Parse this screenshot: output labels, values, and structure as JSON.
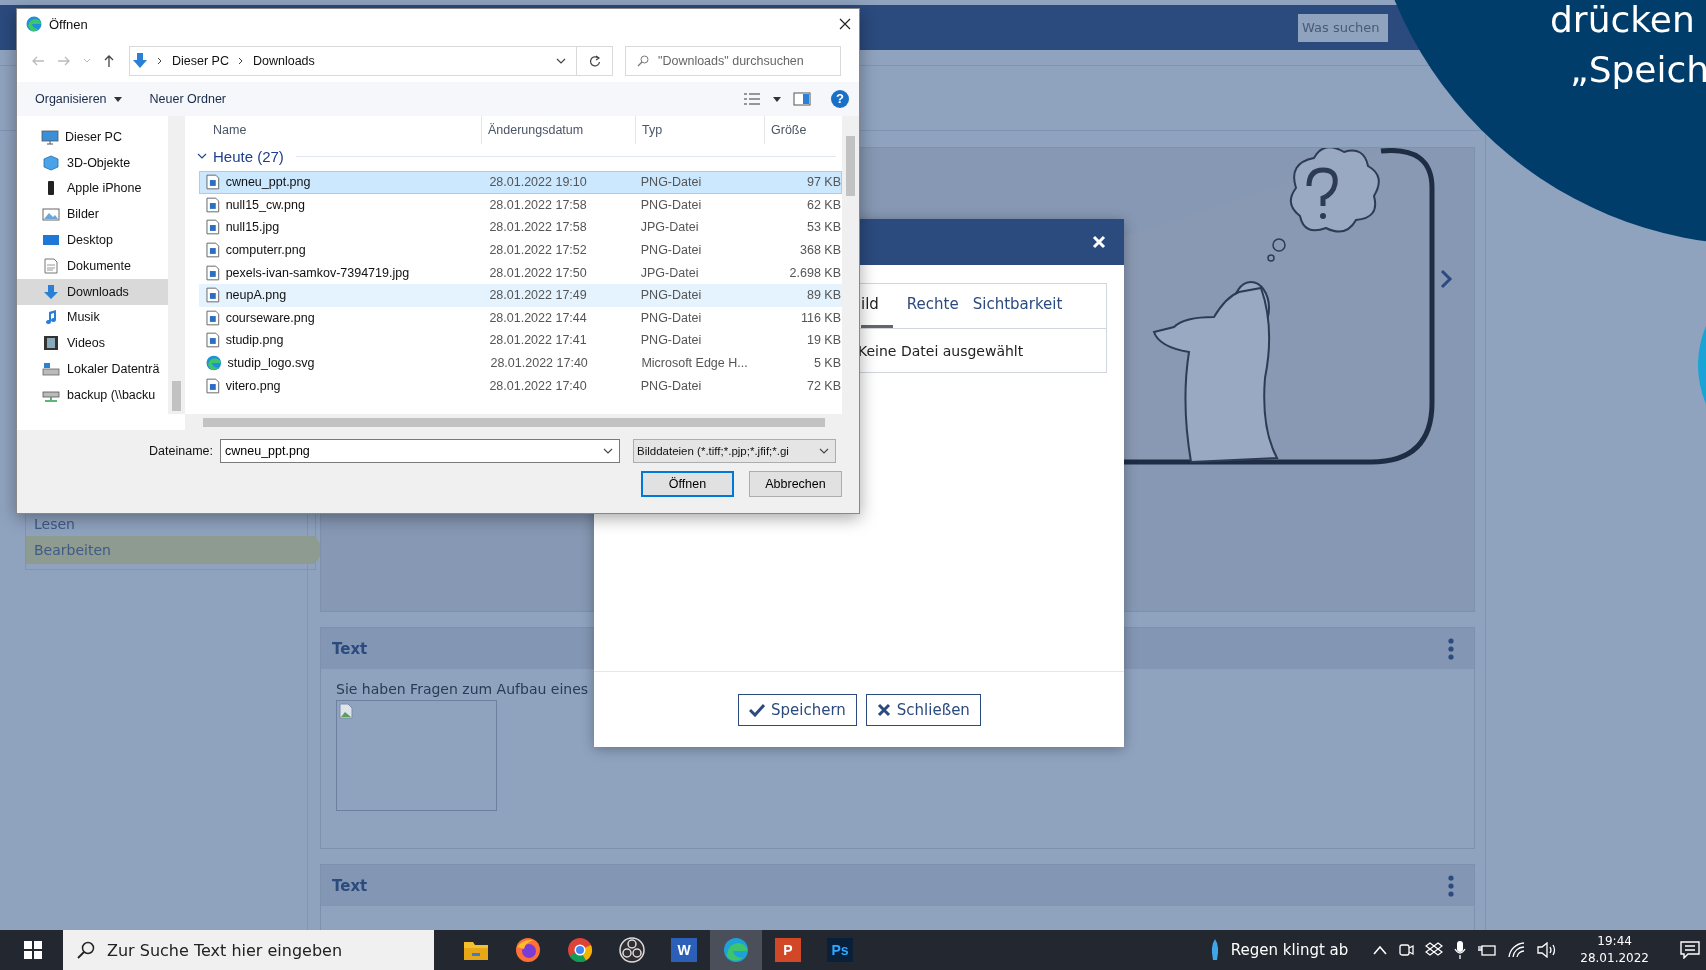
{
  "page": {
    "search": {
      "placeholder": "Was suchen"
    },
    "sidebar": {
      "items": [
        {
          "label": "Lesen",
          "selected": false
        },
        {
          "label": "Bearbeiten",
          "selected": true
        }
      ]
    },
    "text_sections": [
      {
        "title": "Text",
        "body": "Sie haben Fragen zum Aufbau eines",
        "broken_image": true
      },
      {
        "title": "Text",
        "broken_image": false
      }
    ]
  },
  "modal": {
    "tabs": [
      {
        "label": "ild",
        "selected": true
      },
      {
        "label": "Rechte",
        "selected": false
      },
      {
        "label": "Sichtbarkeit",
        "selected": false
      }
    ],
    "file_status": "Keine Datei ausgewählt",
    "buttons": [
      {
        "label": "Speichern",
        "kind": "save"
      },
      {
        "label": "Schließen",
        "kind": "close"
      }
    ]
  },
  "file_dialog": {
    "title": "Öffnen",
    "path": [
      "Dieser PC",
      "Downloads"
    ],
    "search": {
      "placeholder": "\"Downloads\" durchsuchen"
    },
    "toolbar": [
      "Organisieren",
      "Neuer Ordner"
    ],
    "help": "?",
    "nav": [
      {
        "label": "Dieser PC",
        "kind": "pc",
        "selected": false,
        "children": [
          {
            "label": "3D-Objekte",
            "kind": "cube",
            "selected": false
          },
          {
            "label": "Apple iPhone",
            "kind": "phone",
            "selected": false
          },
          {
            "label": "Bilder",
            "kind": "pictures",
            "selected": false
          },
          {
            "label": "Desktop",
            "kind": "desktop",
            "selected": false
          },
          {
            "label": "Dokumente",
            "kind": "docs",
            "selected": false
          },
          {
            "label": "Downloads",
            "kind": "download",
            "selected": true
          },
          {
            "label": "Musik",
            "kind": "music",
            "selected": false
          },
          {
            "label": "Videos",
            "kind": "video",
            "selected": false
          },
          {
            "label": "Lokaler Datenträ",
            "kind": "drive",
            "selected": false
          },
          {
            "label": "backup (\\\\backu",
            "kind": "netdrive",
            "selected": false
          }
        ]
      }
    ],
    "columns": [
      "Name",
      "Änderungsdatum",
      "Typ",
      "Größe"
    ],
    "group": "Heute (27)",
    "files": [
      {
        "name": "cwneu_ppt.png",
        "date": "28.01.2022 19:10",
        "type": "PNG-Datei",
        "size": "97 KB",
        "kind": "image",
        "selected": true,
        "highlighted": false
      },
      {
        "name": "null15_cw.png",
        "date": "28.01.2022 17:58",
        "type": "PNG-Datei",
        "size": "62 KB",
        "kind": "image",
        "selected": false,
        "highlighted": false
      },
      {
        "name": "null15.jpg",
        "date": "28.01.2022 17:58",
        "type": "JPG-Datei",
        "size": "53 KB",
        "kind": "image",
        "selected": false,
        "highlighted": false
      },
      {
        "name": "computerr.png",
        "date": "28.01.2022 17:52",
        "type": "PNG-Datei",
        "size": "368 KB",
        "kind": "image",
        "selected": false,
        "highlighted": false
      },
      {
        "name": "pexels-ivan-samkov-7394719.jpg",
        "date": "28.01.2022 17:50",
        "type": "JPG-Datei",
        "size": "2.698 KB",
        "kind": "image",
        "selected": false,
        "highlighted": false
      },
      {
        "name": "neupA.png",
        "date": "28.01.2022 17:49",
        "type": "PNG-Datei",
        "size": "89 KB",
        "kind": "image",
        "selected": false,
        "highlighted": true
      },
      {
        "name": "courseware.png",
        "date": "28.01.2022 17:44",
        "type": "PNG-Datei",
        "size": "116 KB",
        "kind": "image",
        "selected": false,
        "highlighted": false
      },
      {
        "name": "studip.png",
        "date": "28.01.2022 17:41",
        "type": "PNG-Datei",
        "size": "19 KB",
        "kind": "image",
        "selected": false,
        "highlighted": false
      },
      {
        "name": "studip_logo.svg",
        "date": "28.01.2022 17:40",
        "type": "Microsoft Edge H...",
        "size": "5 KB",
        "kind": "edge",
        "selected": false,
        "highlighted": false
      },
      {
        "name": "vitero.png",
        "date": "28.01.2022 17:40",
        "type": "PNG-Datei",
        "size": "72 KB",
        "kind": "image",
        "selected": false,
        "highlighted": false
      }
    ],
    "filename_label": "Dateiname:",
    "filename": "cwneu_ppt.png",
    "filter": "Bilddateien (*.tiff;*.pjp;*.jfif;*.gi",
    "buttons": [
      {
        "label": "Öffnen",
        "default": true
      },
      {
        "label": "Abbrechen",
        "default": false
      }
    ]
  },
  "callout": {
    "lines": [
      "drücken",
      "„Speich"
    ]
  },
  "taskbar": {
    "search": {
      "placeholder": "Zur Suche Text hier eingeben"
    },
    "apps": [
      {
        "kind": "explorer",
        "selected": false
      },
      {
        "kind": "firefox",
        "selected": false
      },
      {
        "kind": "chrome",
        "selected": false
      },
      {
        "kind": "obs",
        "selected": false
      },
      {
        "kind": "word",
        "label": "W",
        "selected": false
      },
      {
        "kind": "edge",
        "selected": true
      },
      {
        "kind": "powerpoint",
        "label": "P",
        "selected": false
      },
      {
        "kind": "photoshop",
        "label": "Ps",
        "selected": false
      }
    ],
    "weather": "Regen klingt ab",
    "time": "19:44",
    "date": "28.01.2022"
  }
}
